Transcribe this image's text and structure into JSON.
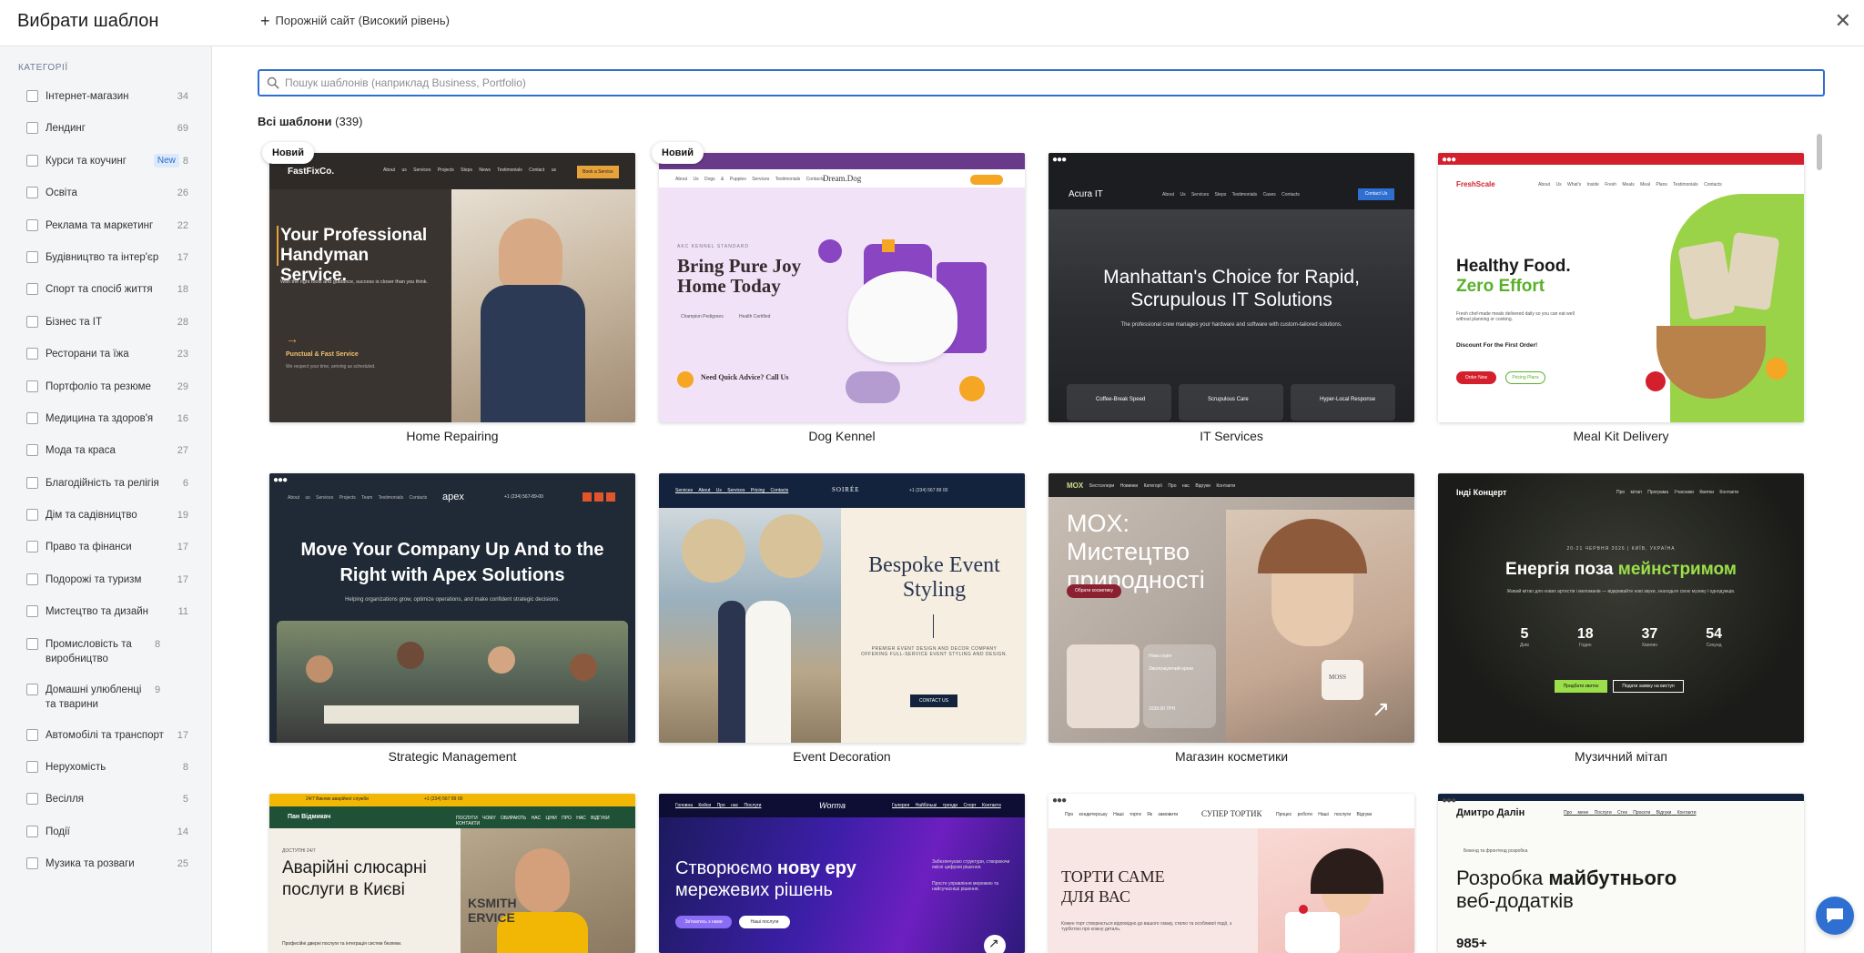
{
  "header": {
    "title": "Вибрати шаблон",
    "empty_site_label": "Порожній сайт (Високий рівень)",
    "close_glyph": "✕"
  },
  "sidebar": {
    "title": "КАТЕГОРІЇ",
    "items": [
      {
        "label": "Інтернет-магазин",
        "count": "34",
        "badge": ""
      },
      {
        "label": "Лендинг",
        "count": "69",
        "badge": ""
      },
      {
        "label": "Курси та коучинг",
        "count": "8",
        "badge": "New"
      },
      {
        "label": "Освіта",
        "count": "26",
        "badge": ""
      },
      {
        "label": "Реклама та маркетинг",
        "count": "22",
        "badge": ""
      },
      {
        "label": "Будівництво та інтер'єр",
        "count": "17",
        "badge": ""
      },
      {
        "label": "Спорт та спосіб життя",
        "count": "18",
        "badge": ""
      },
      {
        "label": "Бізнес та IT",
        "count": "28",
        "badge": ""
      },
      {
        "label": "Ресторани та їжа",
        "count": "23",
        "badge": ""
      },
      {
        "label": "Портфоліо та резюме",
        "count": "29",
        "badge": ""
      },
      {
        "label": "Медицина та здоров'я",
        "count": "16",
        "badge": ""
      },
      {
        "label": "Мода та краса",
        "count": "27",
        "badge": ""
      },
      {
        "label": "Благодійність та релігія",
        "count": "6",
        "badge": ""
      },
      {
        "label": "Дім та садівництво",
        "count": "19",
        "badge": ""
      },
      {
        "label": "Право та фінанси",
        "count": "17",
        "badge": ""
      },
      {
        "label": "Подорожі та туризм",
        "count": "17",
        "badge": ""
      },
      {
        "label": "Мистецтво та дизайн",
        "count": "11",
        "badge": ""
      },
      {
        "label": "Промисловість та виробництво",
        "count": "8",
        "badge": ""
      },
      {
        "label": "Домашні улюбленці та тварини",
        "count": "9",
        "badge": ""
      },
      {
        "label": "Автомобілі та транспорт",
        "count": "17",
        "badge": ""
      },
      {
        "label": "Нерухомість",
        "count": "8",
        "badge": ""
      },
      {
        "label": "Весілля",
        "count": "5",
        "badge": ""
      },
      {
        "label": "Події",
        "count": "14",
        "badge": ""
      },
      {
        "label": "Музика та розваги",
        "count": "25",
        "badge": ""
      }
    ]
  },
  "search": {
    "placeholder": "Пошук шаблонів (наприклад Business, Portfolio)",
    "value": ""
  },
  "templates_title": "Всі шаблони",
  "templates_count": "(339)",
  "new_label": "Новий",
  "templates": [
    {
      "name": "Home Repairing",
      "is_new": true,
      "brand": "FastFixCo.",
      "headline": "Your Professional Handyman Service.",
      "subline": "With the right tools and guidance, success is closer than you think.",
      "tag": "Punctual & Fast Service",
      "tag2": "We respect your time, arriving as scheduled.",
      "cta": "Book a Service",
      "nav": [
        "About us",
        "Services",
        "Projects",
        "Steps",
        "News",
        "Testimonials",
        "Contact us"
      ]
    },
    {
      "name": "Dog Kennel",
      "is_new": true,
      "brand": "Dream.Dog",
      "headline": "Bring Pure Joy Home Today",
      "subline": "Need Quick Advice? Call Us",
      "tag": "AKC KENNEL STANDARD",
      "nav": [
        "About Us",
        "Dogs & Puppies",
        "Services",
        "Testimonials",
        "Contacts"
      ],
      "badge1": "Champion Pedigrees",
      "badge2": "Health Certified"
    },
    {
      "name": "IT Services",
      "is_new": false,
      "brand": "Acura IT",
      "headline": "Manhattan's Choice for Rapid, Scrupulous IT Solutions",
      "subline": "The professional crew manages your hardware and software with custom-tailored solutions.",
      "features": [
        "Coffee-Break Speed",
        "Scrupulous Care",
        "Hyper-Local Response"
      ],
      "cta": "Contact Us",
      "nav": [
        "About Us",
        "Services",
        "Steps",
        "Testimonials",
        "Cases",
        "Contacts"
      ]
    },
    {
      "name": "Meal Kit Delivery",
      "is_new": false,
      "brand": "FreshScale",
      "headline1": "Healthy Food.",
      "headline2": "Zero Effort",
      "subline": "Fresh chef-made meals delivered daily so you can eat well without planning or cooking.",
      "offer": "Discount For the First Order!",
      "cta1": "Order Now",
      "cta2": "Pricing Plans",
      "nav": [
        "About Us",
        "What's Inside",
        "Fresh Meals",
        "Meal Plans",
        "Testimonials",
        "Contacts"
      ]
    },
    {
      "name": "Strategic Management",
      "is_new": false,
      "brand": "apex",
      "headline": "Move Your Company Up And to the Right with Apex Solutions",
      "subline": "Helping organizations grow, optimize operations, and make confident strategic decisions.",
      "nav": [
        "About us",
        "Services",
        "Projects",
        "Team",
        "Testimonials",
        "Contacts"
      ],
      "phone": "+1 (234) 567-89-00"
    },
    {
      "name": "Event Decoration",
      "is_new": false,
      "brand": "SOIRÉE",
      "headline": "Bespoke Event Styling",
      "subline": "PREMIER EVENT DESIGN AND DECOR COMPANY OFFERING FULL-SERVICE EVENT STYLING AND DESIGN.",
      "cta": "CONTACT US",
      "nav": [
        "Services",
        "About Us",
        "Services",
        "Pricing",
        "Contacts"
      ],
      "phone": "+1 (234) 567 89 00"
    },
    {
      "name": "Магазин косметики",
      "is_new": false,
      "brand": "MOX",
      "headline": "MOX: Мистецтво природності",
      "cta": "Обрати косметику",
      "product_tag": "Нова серія",
      "product_name": "Зволожуючий крем",
      "product_price": "1039.00 ГРН",
      "jar_text": "MOSS",
      "nav": [
        "Бестселери",
        "Новинки",
        "Категорії",
        "Про нас",
        "Відгуки",
        "Контакти"
      ]
    },
    {
      "name": "Музичний мітап",
      "is_new": false,
      "brand": "Інді Концерт",
      "date_line": "20-21 ЧЕРВНЯ 2026 | КИЇВ, УКРАЇНА",
      "headline1": "Енергія поза ",
      "headline2": "мейнстримом",
      "subline": "Живий мітап для нових артистів і меломанів — відкривайте нові звуки, знаходьте свою музику і однодумців.",
      "countdown": [
        {
          "value": "5",
          "unit": "Днів"
        },
        {
          "value": "18",
          "unit": "Годин"
        },
        {
          "value": "37",
          "unit": "Хвилин"
        },
        {
          "value": "54",
          "unit": "Секунд"
        }
      ],
      "cta1": "Придбати квиток",
      "cta2": "Подати заявку на виступ",
      "nav": [
        "Про мітап",
        "Програма",
        "Учасники",
        "Квитки",
        "Контакти"
      ]
    },
    {
      "name": "",
      "is_new": false,
      "brand": "Пан Відмикач",
      "top_bar": "24/7 Виклик аварійної служби",
      "phone": "+1 (234) 567 89 00",
      "kicker": "ДОСТУПНІ 24/7",
      "headline": "Аварійні слюсарні послуги в Києві",
      "subline": "Професійні дверні послуги та інтеграція систем безпеки.",
      "sign": "KSMITH ERVICE",
      "nav": [
        "ПОСЛУГИ",
        "ЧОМУ ОБИРАЮТЬ НАС",
        "ЦІНИ",
        "ПРО НАС",
        "ВІДГУКИ",
        "КОНТАКТИ"
      ]
    },
    {
      "name": "",
      "is_new": false,
      "brand": "Worma",
      "headline1": "Створюємо ",
      "headline2": "нову еру",
      "headline3": "мережевих рішень",
      "side_text": "Забезпечуємо структури, створюючи якісні цифрові рішення.",
      "side_text2": "Просте управління мережею та найсучасніші рішення.",
      "cta1": "Зв'язатись з нами",
      "cta2": "Наші послуги",
      "nav_left": [
        "Головна",
        "Кейси",
        "Про нас",
        "Послуги"
      ],
      "nav_right": [
        "Галерея",
        "Найбільші тренди",
        "Спорт",
        "Контакти"
      ]
    },
    {
      "name": "",
      "is_new": false,
      "brand": "СУПЕР ТОРТИК",
      "headline": "ТОРТИ САМЕ ДЛЯ ВАС",
      "subline": "Кожен торт створюється відповідно до вашого смаку, стилю та особливої події, з турботою про кожну деталь.",
      "nav_left": [
        "Про кондитерську",
        "Наші торти",
        "Як замовити"
      ],
      "nav_right": [
        "Процес роботи",
        "Наші послуги",
        "Відгуки"
      ]
    },
    {
      "name": "",
      "is_new": false,
      "brand": "Дмитро Далін",
      "headline1": "Розробка ",
      "headline2": "майбутнього",
      "headline3": "веб-додатків",
      "kicker": "Бекенд та фронтенд розробка",
      "stat": "985+",
      "nav": [
        "Про мене",
        "Послуги",
        "Стек",
        "Проєкти",
        "Відгуки",
        "Контакти"
      ]
    }
  ],
  "colors": {
    "accent": "#2f6fd1",
    "sidebar_bg": "#f4f5f7",
    "new_badge_bg": "#dbe9fb",
    "new_badge_text": "#2a6cc9"
  },
  "icons": {
    "search": "search-icon",
    "plus": "plus-icon",
    "close": "close-icon",
    "chat": "chat-icon"
  }
}
